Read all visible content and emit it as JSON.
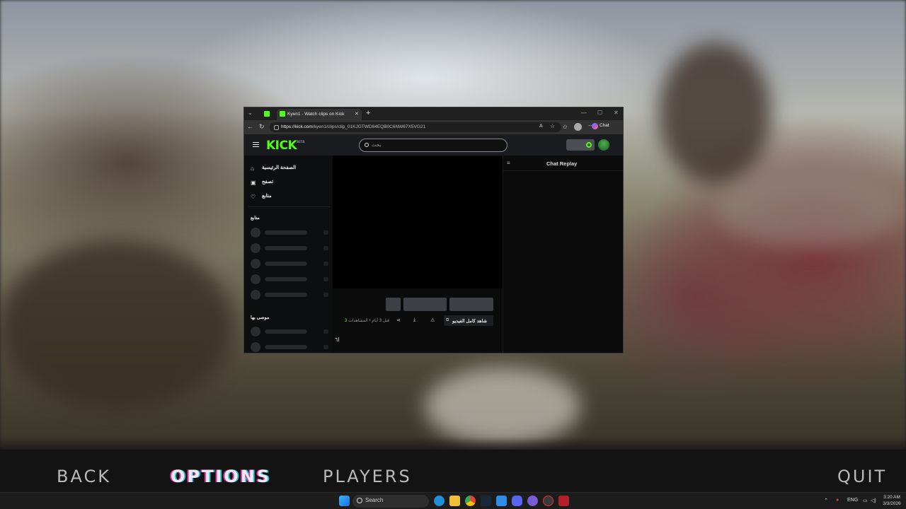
{
  "game_menu": {
    "back": "BACK",
    "options": "OPTIONS",
    "players": "PLAYERS",
    "quit": "QUIT"
  },
  "browser": {
    "tab_title": "Kyen1 - Watch clips on Kick",
    "url_host": "https://kick.com",
    "url_path": "/kyen1/clips/clip_01KJGTWD84EQB0C6NW67X5VG21",
    "copilot_label": "Chat"
  },
  "kick": {
    "logo": "KICK",
    "logo_badge": "BETA",
    "search_placeholder": "بحث",
    "nav": [
      {
        "label": "الصفحة الرئيسية",
        "icon": "home-icon"
      },
      {
        "label": "تصفح",
        "icon": "browse-icon"
      },
      {
        "label": "متابع",
        "icon": "heart-icon"
      }
    ],
    "following_heading": "متابع",
    "recommended_heading": "موصى بها",
    "clip": {
      "watch_full": "شاهد كامل الفيديو",
      "views_text": "قبل 3 أيام • المشاهدات",
      "views_count": "3",
      "title": "ا٦"
    },
    "chat_title": "Chat Replay"
  },
  "taskbar": {
    "search_label": "Search",
    "lang": "ENG",
    "time": "3:20 AM",
    "date": "3/3/2026"
  },
  "colors": {
    "kick_green": "#53fc18",
    "options_magenta": "#d03a9c",
    "options_cyan": "#2ac4d4"
  }
}
